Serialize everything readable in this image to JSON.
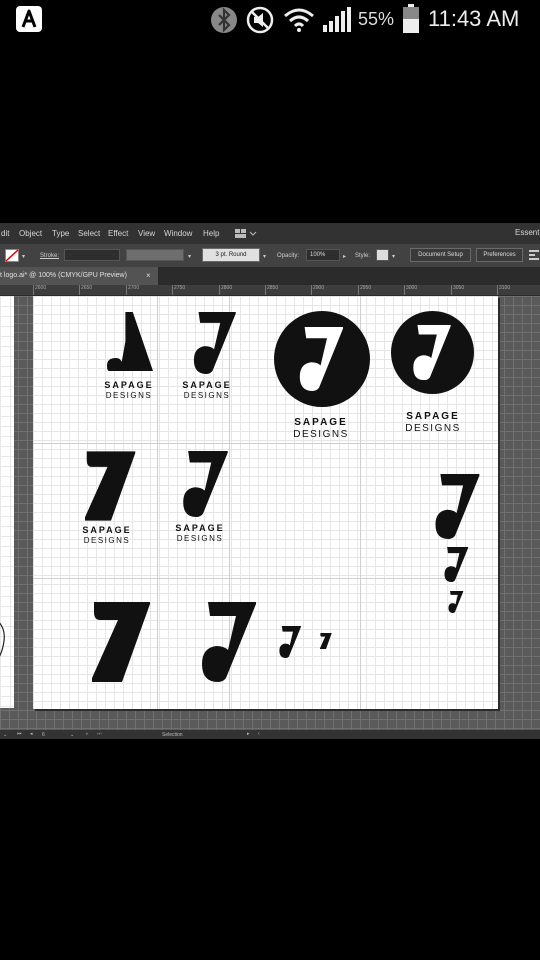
{
  "status_bar": {
    "battery_percent": "55%",
    "time": "11:43 AM",
    "icons": [
      "app-badge-icon",
      "bluetooth-icon",
      "mute-icon",
      "wifi-icon",
      "signal-icon",
      "battery-icon"
    ]
  },
  "illustrator": {
    "menu": [
      "dit",
      "Object",
      "Type",
      "Select",
      "Effect",
      "View",
      "Window",
      "Help"
    ],
    "workspace_label": "Essent",
    "control_bar": {
      "stroke_label": "Stroke:",
      "brush_label": "3 pt. Round",
      "opacity_label": "Opacity:",
      "opacity_value": "100%",
      "style_label": "Style:",
      "document_setup": "Document Setup",
      "preferences": "Preferences"
    },
    "document_tab": {
      "title": "t logo.ai* @ 100% (CMYK/GPU Preview)",
      "close": "×"
    },
    "ruler_ticks": [
      "2600",
      "2650",
      "2700",
      "2750",
      "2800",
      "2850",
      "2900",
      "2950",
      "3000",
      "3050",
      "3100"
    ],
    "logo_caption": {
      "line1": "SAPAGE",
      "line2": "DESIGNS"
    },
    "status_strip": {
      "zoom_page": "6",
      "tool": "Selection"
    }
  },
  "colors": {
    "pasteboard": "#535353",
    "artboard": "#ffffff",
    "logo": "#111111"
  }
}
